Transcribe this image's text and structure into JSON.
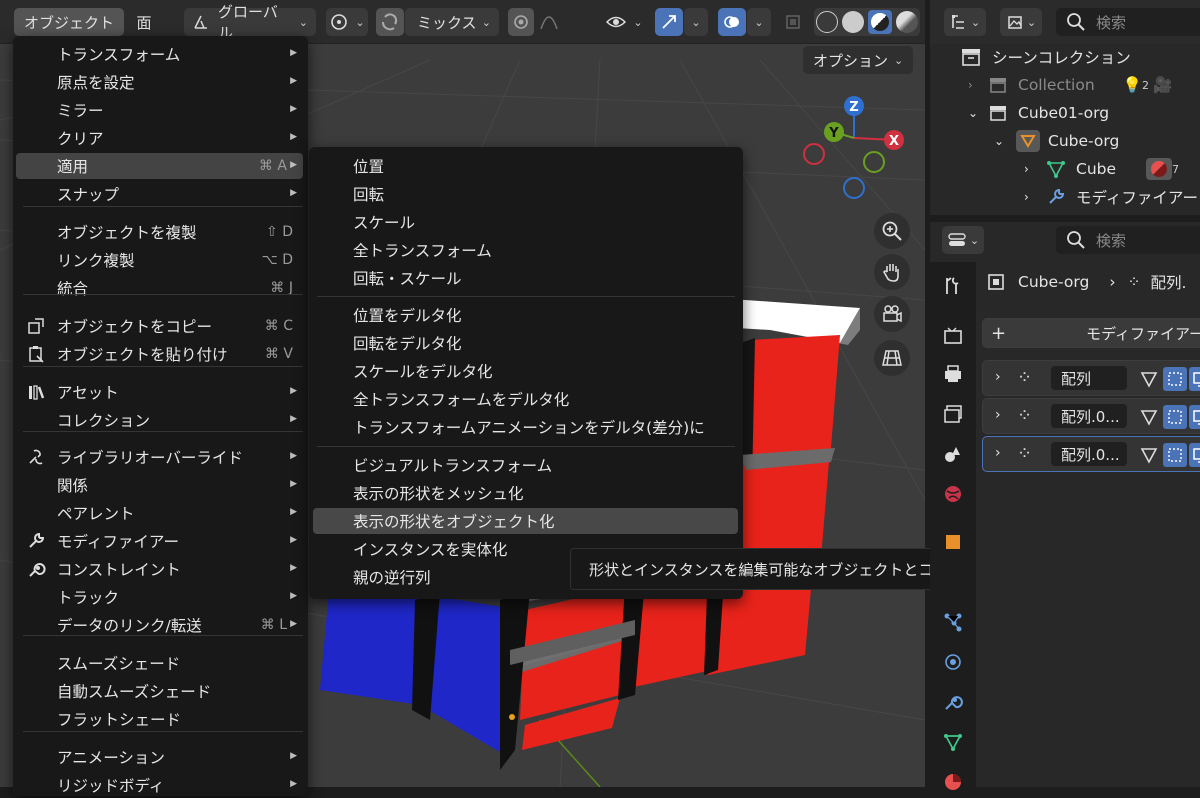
{
  "header": {
    "object_menu": "オブジェクト",
    "face_menu": "面",
    "transform_orientation": "グローバル",
    "snap_mode": "ミックス",
    "options": "オプション"
  },
  "object_menu": {
    "items": [
      {
        "label": "トランスフォーム",
        "submenu": true
      },
      {
        "label": "原点を設定",
        "submenu": true
      },
      {
        "label": "ミラー",
        "submenu": true
      },
      {
        "label": "クリア",
        "submenu": true
      },
      {
        "label": "適用",
        "shortcut": "⌘ A",
        "submenu": true
      },
      {
        "label": "スナップ",
        "submenu": true
      },
      {
        "label": "オブジェクトを複製",
        "shortcut": "⇧ D"
      },
      {
        "label": "リンク複製",
        "shortcut": "⌥ D"
      },
      {
        "label": "統合",
        "shortcut": "⌘ J"
      },
      {
        "label": "オブジェクトをコピー",
        "shortcut": "⌘ C",
        "icon": "copy-icon"
      },
      {
        "label": "オブジェクトを貼り付け",
        "shortcut": "⌘ V",
        "icon": "paste-icon"
      },
      {
        "label": "アセット",
        "submenu": true,
        "icon": "asset-icon"
      },
      {
        "label": "コレクション",
        "submenu": true
      },
      {
        "label": "ライブラリオーバーライド",
        "submenu": true,
        "icon": "library-override-icon"
      },
      {
        "label": "関係",
        "submenu": true
      },
      {
        "label": "ペアレント",
        "submenu": true
      },
      {
        "label": "モディファイアー",
        "submenu": true,
        "icon": "wrench-icon"
      },
      {
        "label": "コンストレイント",
        "submenu": true,
        "icon": "constraint-icon"
      },
      {
        "label": "トラック",
        "submenu": true
      },
      {
        "label": "データのリンク/転送",
        "shortcut": "⌘ L",
        "submenu": true
      },
      {
        "label": "スムーズシェード"
      },
      {
        "label": "自動スムーズシェード"
      },
      {
        "label": "フラットシェード"
      },
      {
        "label": "アニメーション",
        "submenu": true
      },
      {
        "label": "リジッドボディ",
        "submenu": true
      }
    ]
  },
  "apply_submenu": {
    "items": [
      "位置",
      "回転",
      "スケール",
      "全トランスフォーム",
      "回転・スケール",
      "位置をデルタ化",
      "回転をデルタ化",
      "スケールをデルタ化",
      "全トランスフォームをデルタ化",
      "トランスフォームアニメーションをデルタ(差分)に",
      "ビジュアルトランスフォーム",
      "表示の形状をメッシュ化",
      "表示の形状をオブジェクト化",
      "インスタンスを実体化",
      "親の逆行列"
    ],
    "highlighted": "表示の形状をオブジェクト化"
  },
  "tooltip": "形状とインスタンスを編集可能なオブジェクトとコレクションに変換します.",
  "gizmo": {
    "x": "X",
    "y": "Y",
    "z": "Z"
  },
  "outliner": {
    "search_placeholder": "検索",
    "scene_collection": "シーンコレクション",
    "rows": [
      {
        "label": "Collection",
        "badge": "2"
      },
      {
        "label": "Cube01-org"
      },
      {
        "label": "Cube-org"
      },
      {
        "label": "Cube",
        "badge": "7"
      },
      {
        "label": "モディファイアー"
      }
    ]
  },
  "properties": {
    "search_placeholder": "検索",
    "breadcrumb_object": "Cube-org",
    "breadcrumb_modifier": "配列.",
    "add_modifier": "モディファイアー",
    "modifiers": [
      "配列",
      "配列.0...",
      "配列.0..."
    ]
  },
  "colors": {
    "accent": "#4a73b8",
    "highlight": "#444444",
    "cube_red": "#e8231b",
    "cube_blue": "#1f27c9"
  }
}
